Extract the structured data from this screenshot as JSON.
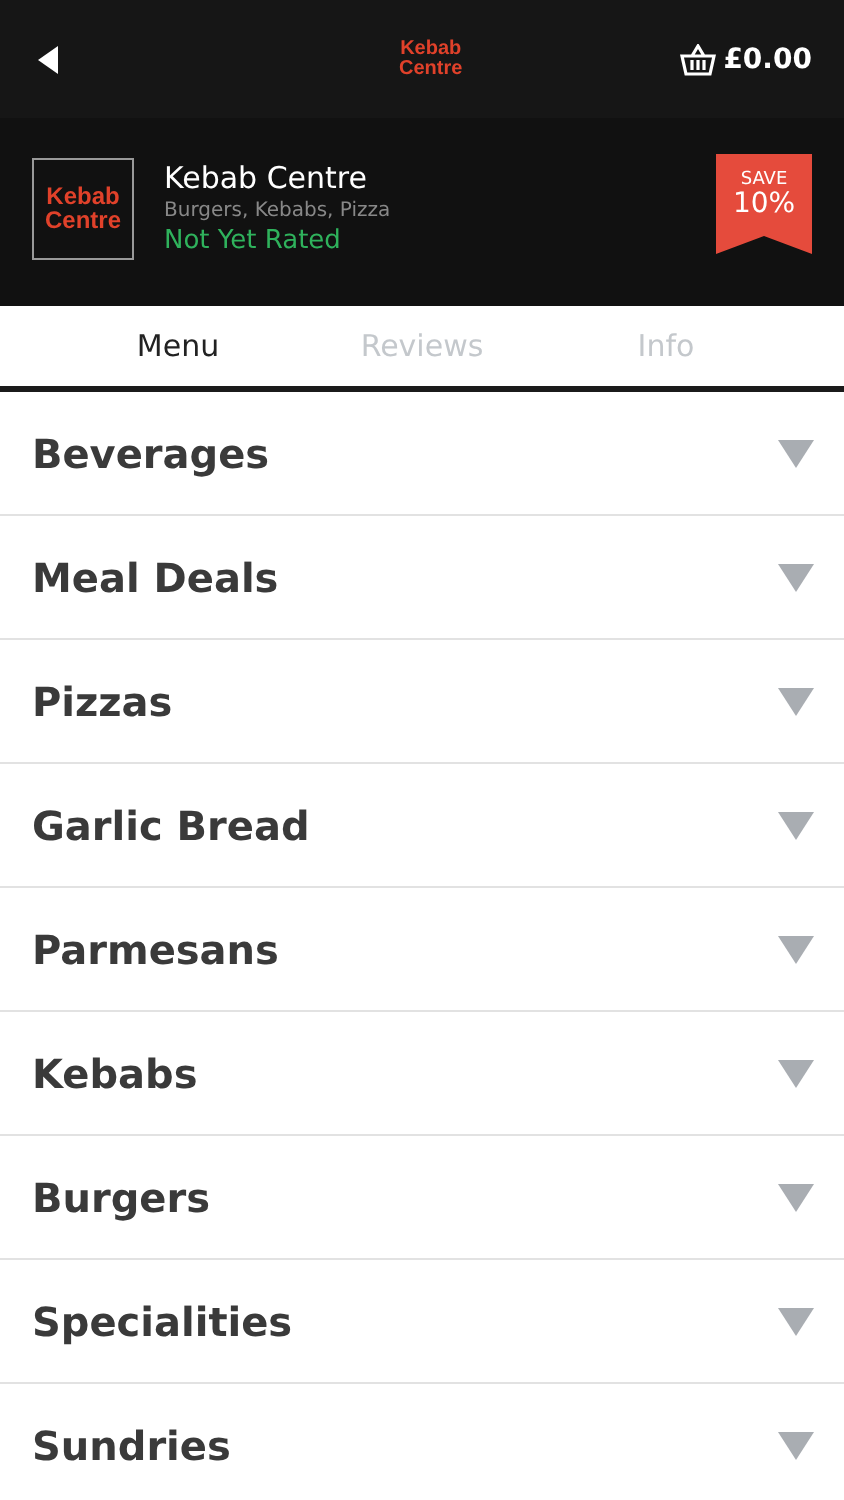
{
  "top_bar": {
    "logo": [
      "Kebab",
      "Centre"
    ],
    "basket_total": "£0.00"
  },
  "restaurant": {
    "logo": [
      "Kebab",
      "Centre"
    ],
    "name": "Kebab Centre",
    "cuisines": "Burgers, Kebabs, Pizza",
    "rating": "Not Yet Rated",
    "badge": {
      "label": "SAVE",
      "value": "10%"
    }
  },
  "tabs": [
    {
      "label": "Menu",
      "selected": true
    },
    {
      "label": "Reviews",
      "selected": false
    },
    {
      "label": "Info",
      "selected": false
    }
  ],
  "categories": [
    {
      "name": "Beverages",
      "expanded": false
    },
    {
      "name": "Meal Deals",
      "expanded": false
    },
    {
      "name": "Pizzas",
      "expanded": false
    },
    {
      "name": "Garlic Bread",
      "expanded": false
    },
    {
      "name": "Parmesans",
      "expanded": false
    },
    {
      "name": "Kebabs",
      "expanded": false
    },
    {
      "name": "Burgers",
      "expanded": false
    },
    {
      "name": "Specialities",
      "expanded": false
    },
    {
      "name": "Sundries",
      "expanded": false
    }
  ]
}
